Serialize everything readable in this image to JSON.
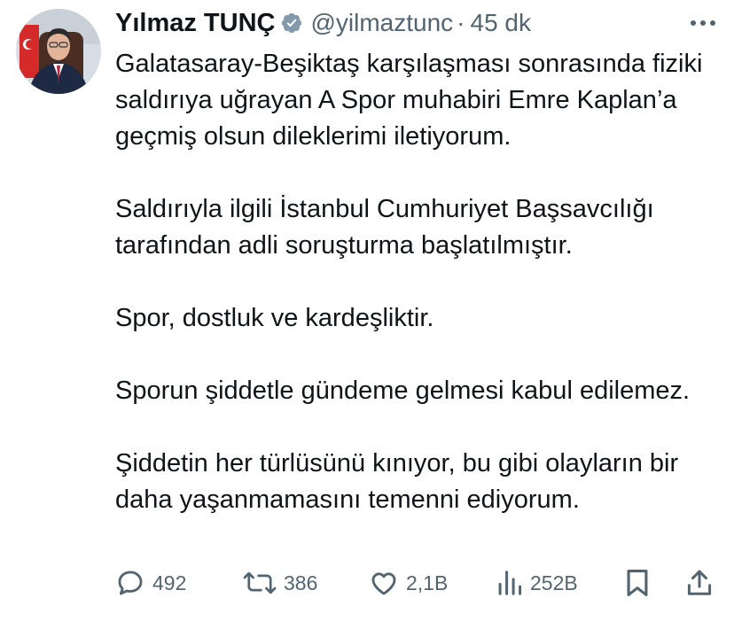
{
  "author": {
    "display_name": "Yılmaz TUNÇ",
    "handle": "@yilmaztunc",
    "separator": "·",
    "time": "45 dk",
    "verified_badge_color": "#829aab"
  },
  "tweet": {
    "paragraphs": [
      "Galatasaray-Beşiktaş karşılaşması sonrasında fiziki saldırıya uğrayan A Spor muhabiri Emre Kaplan’a geçmiş olsun dileklerimi iletiyorum.",
      "Saldırıyla ilgili İstanbul Cumhuriyet Başsavcılığı tarafından adli soruşturma başlatılmıştır.",
      "Spor, dostluk ve kardeşliktir.",
      "Sporun şiddetle gündeme gelmesi kabul edilemez.",
      "Şiddetin her türlüsünü kınıyor, bu gibi olayların bir daha yaşanmamasını temenni ediyorum."
    ]
  },
  "actions": {
    "replies": {
      "icon": "reply-icon",
      "count": "492"
    },
    "retweets": {
      "icon": "retweet-icon",
      "count": "386"
    },
    "likes": {
      "icon": "heart-icon",
      "count": "2,1B"
    },
    "views": {
      "icon": "views-icon",
      "count": "252B"
    },
    "bookmark": {
      "icon": "bookmark-icon"
    },
    "share": {
      "icon": "share-icon"
    }
  },
  "colors": {
    "text": "#0f1419",
    "secondary": "#536471",
    "background": "#ffffff"
  }
}
